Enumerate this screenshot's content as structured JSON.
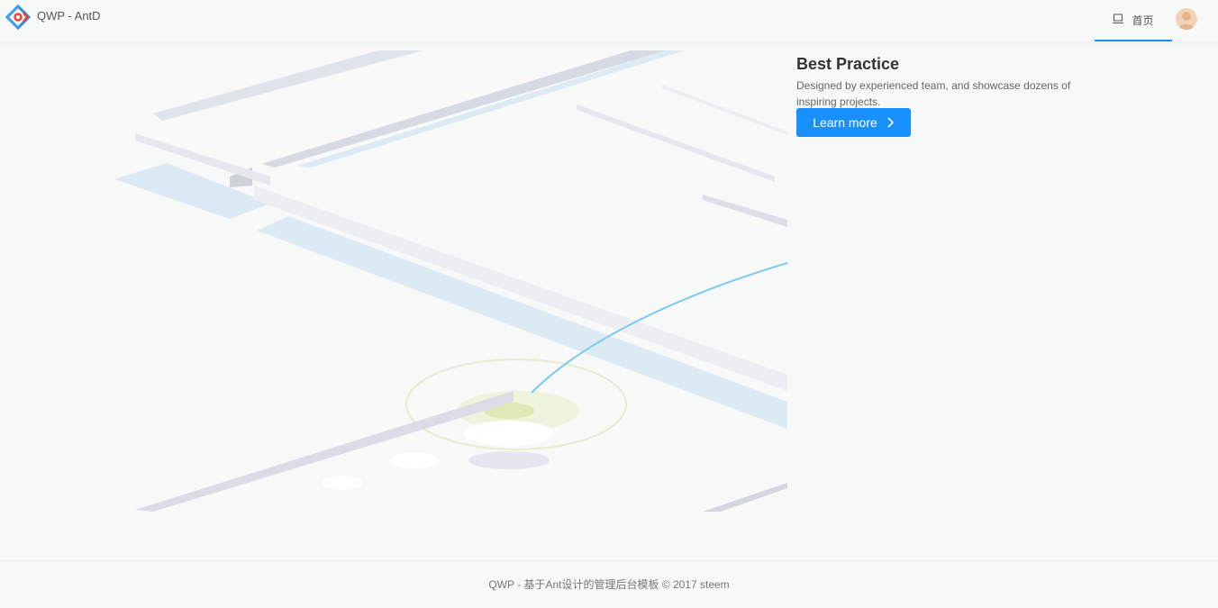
{
  "header": {
    "app_title": "QWP - AntD",
    "nav": {
      "home_label": "首页",
      "home_icon": "laptop-icon"
    },
    "logo_icon": "antd-logo-icon",
    "avatar_icon": "user-avatar-icon"
  },
  "feature": {
    "title": "Best Practice",
    "description": "Designed by experienced team, and showcase dozens of inspiring projects.",
    "button_label": "Learn more",
    "button_icon": "chevron-right-icon"
  },
  "footer": {
    "text": "QWP - 基于Ant设计的管理后台模板 © 2017 steem"
  },
  "colors": {
    "accent": "#1890ff",
    "background": "#f7f8f8"
  }
}
